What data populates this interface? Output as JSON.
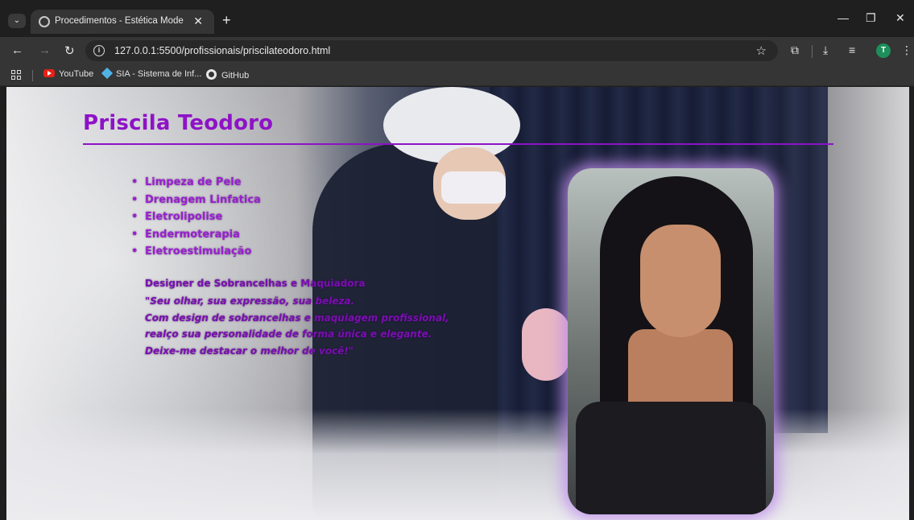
{
  "browser": {
    "tab_title": "Procedimentos - Estética Mode",
    "url": "127.0.0.1:5500/profissionais/priscilateodoro.html",
    "profile_initial": "T",
    "bookmarks": [
      {
        "label": "YouTube",
        "icon": "youtube-icon"
      },
      {
        "label": "SIA - Sistema de Inf...",
        "icon": "sia-icon"
      },
      {
        "label": "GitHub",
        "icon": "github-icon"
      }
    ]
  },
  "page": {
    "name": "Priscila Teodoro",
    "procedures": [
      "Limpeza de Pele",
      "Drenagem Linfatica",
      "Eletrolipolise",
      "Endermoterapia",
      "Eletroestimulação"
    ],
    "role": "Designer de Sobrancelhas e Maquiadora",
    "quote_lines": [
      "\"Seu olhar, sua expressão, sua beleza.",
      "Com design de sobrancelhas e maquiagem profissional,",
      "realço sua personalidade de forma única e elegante.",
      "Deixe-me destacar o melhor de você!\""
    ],
    "accent_color": "#8e12c7"
  }
}
